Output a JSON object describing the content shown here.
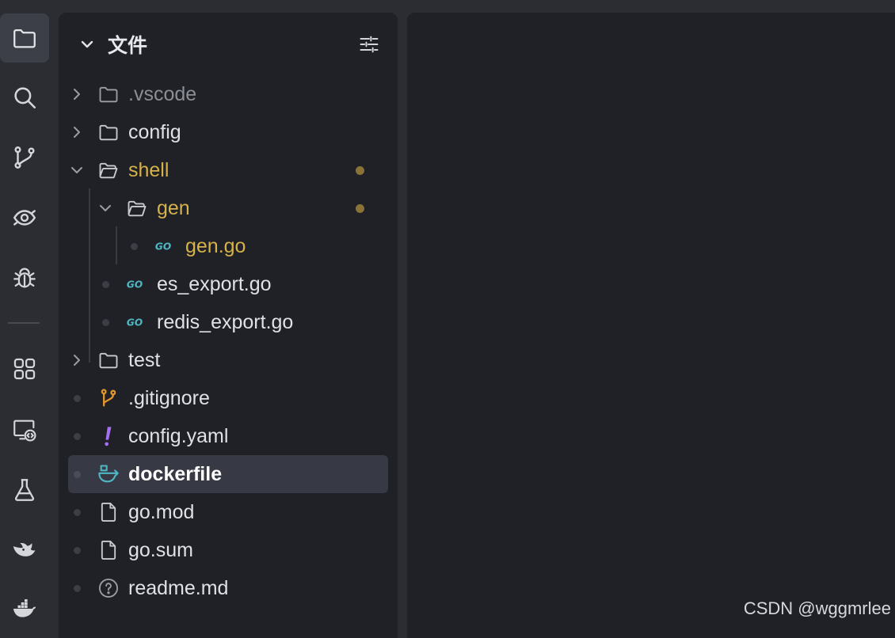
{
  "activity_bar": {
    "items": [
      {
        "name": "explorer",
        "icon": "folder-icon",
        "active": true
      },
      {
        "name": "search",
        "icon": "search-icon"
      },
      {
        "name": "source-control",
        "icon": "git-branch-icon"
      },
      {
        "name": "watch",
        "icon": "eye-icon"
      },
      {
        "name": "debug",
        "icon": "bug-icon"
      },
      {
        "name": "extensions",
        "icon": "extensions-icon"
      },
      {
        "name": "remote-explorer",
        "icon": "remote-monitor-icon"
      },
      {
        "name": "testing",
        "icon": "flask-icon"
      },
      {
        "name": "deepseek",
        "icon": "whale-icon"
      },
      {
        "name": "docker",
        "icon": "docker-icon"
      }
    ]
  },
  "explorer": {
    "title": "文件",
    "tree": [
      {
        "label": ".vscode",
        "kind": "folder",
        "state": "collapsed",
        "depth": 0,
        "style": "dim"
      },
      {
        "label": "config",
        "kind": "folder",
        "state": "collapsed",
        "depth": 0
      },
      {
        "label": "shell",
        "kind": "folder",
        "state": "expanded",
        "depth": 0,
        "style": "modified",
        "modified": true
      },
      {
        "label": "gen",
        "kind": "folder",
        "state": "expanded",
        "depth": 1,
        "style": "modified",
        "modified": true
      },
      {
        "label": "gen.go",
        "kind": "go-file",
        "depth": 2,
        "style": "modified"
      },
      {
        "label": "es_export.go",
        "kind": "go-file",
        "depth": 1
      },
      {
        "label": "redis_export.go",
        "kind": "go-file",
        "depth": 1
      },
      {
        "label": "test",
        "kind": "folder",
        "state": "collapsed",
        "depth": 0
      },
      {
        "label": ".gitignore",
        "kind": "git-file",
        "depth": 0
      },
      {
        "label": "config.yaml",
        "kind": "yaml-file",
        "depth": 0
      },
      {
        "label": "dockerfile",
        "kind": "docker-file",
        "depth": 0,
        "selected": true
      },
      {
        "label": "go.mod",
        "kind": "file",
        "depth": 0
      },
      {
        "label": "go.sum",
        "kind": "file",
        "depth": 0
      },
      {
        "label": "readme.md",
        "kind": "unknown-file",
        "depth": 0
      }
    ]
  },
  "colors": {
    "modified": "#d7b24a",
    "go_icon": "#4fb7c4",
    "git_icon": "#e0952f",
    "yaml_icon": "#a66ff2",
    "docker_icon": "#4fb7c4",
    "selection": "#373a44"
  },
  "watermark": "CSDN @wggmrlee"
}
